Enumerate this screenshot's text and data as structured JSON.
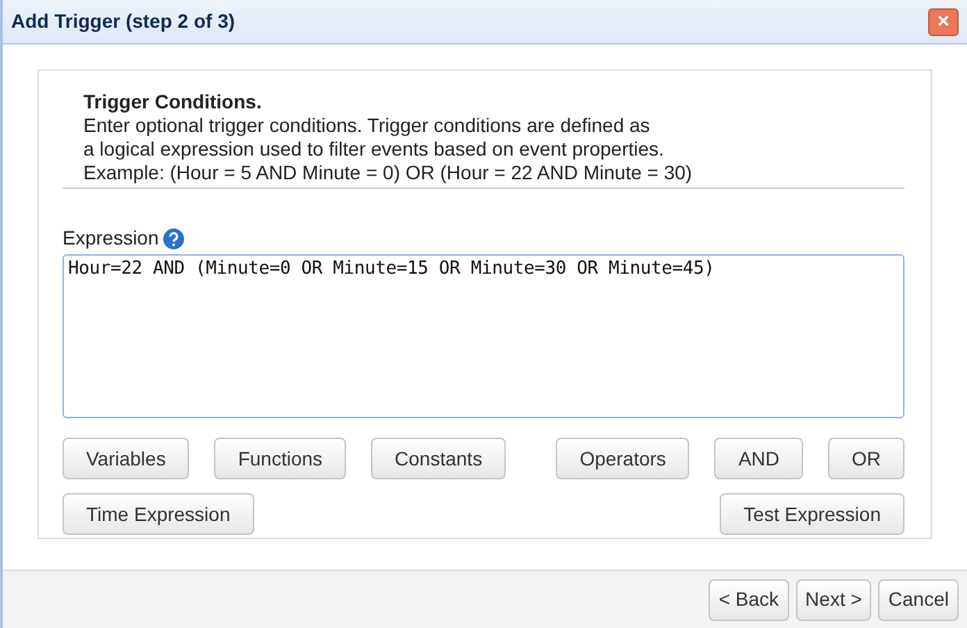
{
  "window": {
    "title": "Add Trigger (step 2 of 3)",
    "close": "×"
  },
  "intro": {
    "heading": "Trigger Conditions.",
    "lines": [
      "Enter optional trigger conditions. Trigger conditions are defined as",
      "a logical expression used to filter events based on event properties.",
      "Example: (Hour = 5 AND Minute = 0) OR (Hour = 22 AND Minute = 30)"
    ]
  },
  "expression": {
    "label": "Expression",
    "value": "Hour=22 AND (Minute=0 OR Minute=15 OR Minute=30 OR Minute=45)"
  },
  "button_rows": [
    {
      "left": [
        "Variables",
        "Functions",
        "Constants"
      ],
      "right": [
        "Operators",
        "AND",
        "OR"
      ]
    },
    {
      "left": [
        "Time Expression"
      ],
      "right": [
        "Test Expression"
      ]
    }
  ],
  "footer_buttons": [
    "< Back",
    "Next >",
    "Cancel"
  ]
}
